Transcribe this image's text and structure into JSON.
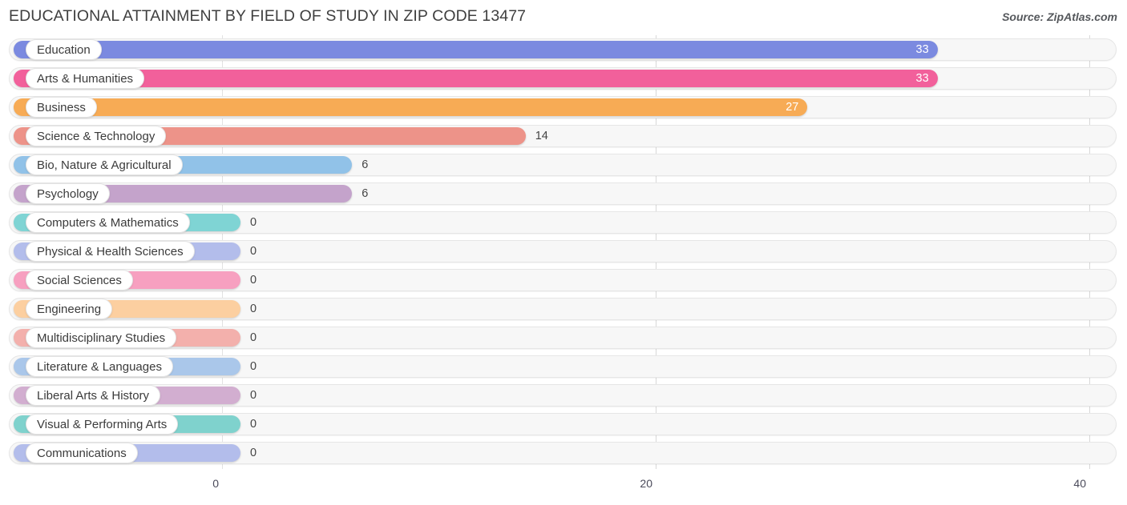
{
  "header": {
    "title": "EDUCATIONAL ATTAINMENT BY FIELD OF STUDY IN ZIP CODE 13477",
    "source": "Source: ZipAtlas.com"
  },
  "chart_data": {
    "type": "bar",
    "orientation": "horizontal",
    "title": "EDUCATIONAL ATTAINMENT BY FIELD OF STUDY IN ZIP CODE 13477",
    "xlabel": "",
    "ylabel": "",
    "xlim": [
      0,
      40
    ],
    "xticks": [
      "0",
      "20",
      "40"
    ],
    "xtick_values": [
      0,
      20,
      40
    ],
    "grid": true,
    "legend": false,
    "categories": [
      "Education",
      "Arts & Humanities",
      "Business",
      "Science & Technology",
      "Bio, Nature & Agricultural",
      "Psychology",
      "Computers & Mathematics",
      "Physical & Health Sciences",
      "Social Sciences",
      "Engineering",
      "Multidisciplinary Studies",
      "Literature & Languages",
      "Liberal Arts & History",
      "Visual & Performing Arts",
      "Communications"
    ],
    "values": [
      33,
      33,
      27,
      14,
      6,
      6,
      0,
      0,
      0,
      0,
      0,
      0,
      0,
      0,
      0
    ],
    "value_labels": [
      "33",
      "33",
      "27",
      "14",
      "6",
      "6",
      "0",
      "0",
      "0",
      "0",
      "0",
      "0",
      "0",
      "0",
      "0"
    ],
    "colors": [
      "#7b8ae0",
      "#f2609b",
      "#f7ab55",
      "#ed9389",
      "#91c2e8",
      "#c4a3cb",
      "#7fd4d4",
      "#b3bdeb",
      "#f7a0c0",
      "#fccfa0",
      "#f3b0ac",
      "#aac7ea",
      "#d2aed0",
      "#7fd2cd",
      "#b3bdeb"
    ]
  }
}
